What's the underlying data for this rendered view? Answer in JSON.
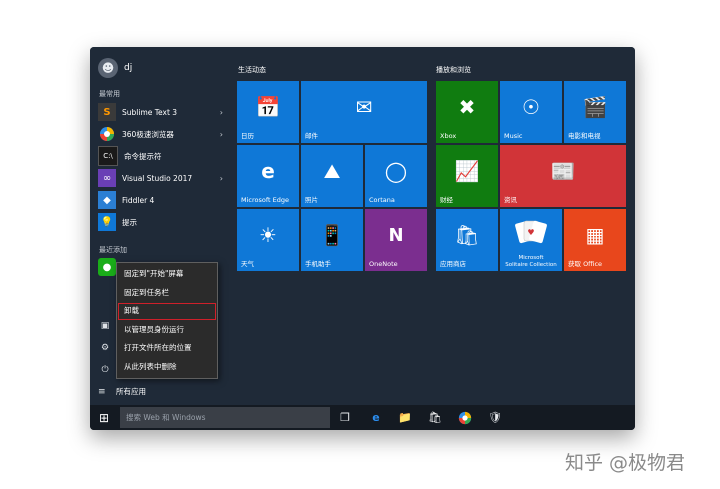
{
  "start_menu": {
    "user": {
      "name": "dj",
      "avatar_icon": "user-avatar-icon"
    },
    "most_used_label": "最常用",
    "most_used": [
      {
        "label": "Sublime Text 3",
        "icon": "sublime-icon",
        "color": "#3a3a3a",
        "has_submenu": true
      },
      {
        "label": "360极速浏览器",
        "icon": "360-browser-icon",
        "color": "#2f8fe6",
        "has_submenu": true
      },
      {
        "label": "命令提示符",
        "icon": "cmd-icon",
        "color": "#1a1a1a",
        "has_submenu": false
      },
      {
        "label": "Visual Studio 2017",
        "icon": "visual-studio-icon",
        "color": "#6a3fb5",
        "has_submenu": true
      },
      {
        "label": "Fiddler 4",
        "icon": "fiddler-icon",
        "color": "#2b7fd4",
        "has_submenu": false
      },
      {
        "label": "提示",
        "icon": "tips-icon",
        "color": "#0f78d7",
        "has_submenu": false
      }
    ],
    "recently_added_label": "最近添加",
    "all_apps_label": "所有应用"
  },
  "context_menu": {
    "items": [
      {
        "label": "固定到\"开始\"屏幕",
        "highlighted": false
      },
      {
        "label": "固定到任务栏",
        "highlighted": false
      },
      {
        "label": "卸载",
        "highlighted": true
      },
      {
        "label": "以管理员身份运行",
        "highlighted": false
      },
      {
        "label": "打开文件所在的位置",
        "highlighted": false
      },
      {
        "label": "从此列表中删除",
        "highlighted": false
      }
    ]
  },
  "groups": {
    "life": {
      "title": "生活动态"
    },
    "play": {
      "title": "播放和浏览"
    }
  },
  "tiles": {
    "calendar": {
      "label": "日历",
      "color": "#0f78d7"
    },
    "mail": {
      "label": "邮件",
      "color": "#0f78d7"
    },
    "edge": {
      "label": "Microsoft Edge",
      "color": "#0f78d7"
    },
    "photos": {
      "label": "照片",
      "color": "#0f78d7"
    },
    "cortana": {
      "label": "Cortana",
      "color": "#0f78d7"
    },
    "weather": {
      "label": "天气",
      "color": "#0f78d7"
    },
    "phone": {
      "label": "手机助手",
      "color": "#0f78d7"
    },
    "onenote": {
      "label": "OneNote",
      "color": "#7b2e8f"
    },
    "xbox": {
      "label": "Xbox",
      "color": "#107c10"
    },
    "music": {
      "label": "Music",
      "color": "#0f78d7"
    },
    "movies": {
      "label": "电影和电视",
      "color": "#0f78d7"
    },
    "news": {
      "label": "资讯",
      "color": "#d13438"
    },
    "finance": {
      "label": "财经",
      "color": "#107c10"
    },
    "store": {
      "label": "应用商店",
      "color": "#0f78d7"
    },
    "solitaire": {
      "label_line1": "Microsoft",
      "label_line2": "Solitaire Collection",
      "color": "#0f78d7"
    },
    "office": {
      "label": "获取 Office",
      "color": "#e8471c"
    }
  },
  "taskbar": {
    "search_placeholder": "搜索 Web 和 Windows"
  },
  "watermark": "知乎 @极物君"
}
